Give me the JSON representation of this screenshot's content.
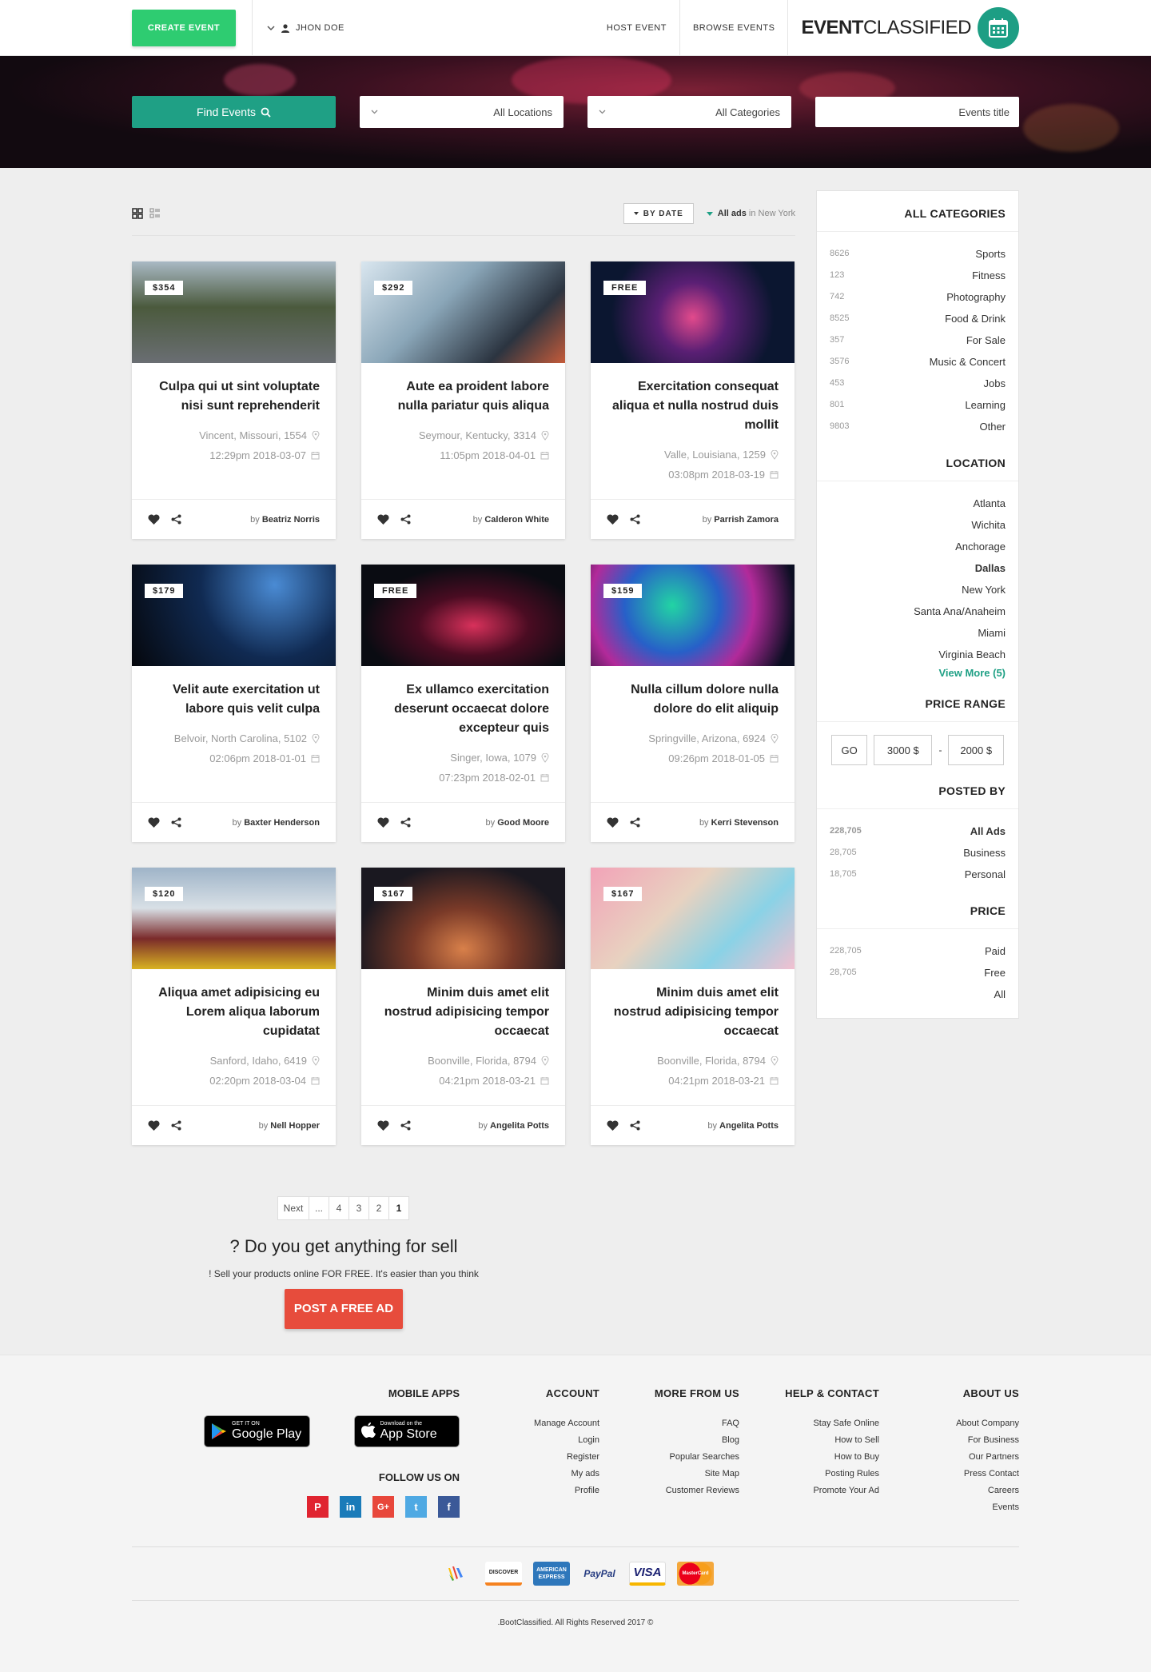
{
  "header": {
    "create_event": "CREATE EVENT",
    "user_name": "JHON DOE",
    "nav": [
      "HOST EVENT",
      "BROWSE EVENTS"
    ],
    "logo_bold": "EVENT",
    "logo_light": "CLASSIFIED"
  },
  "hero": {
    "find_events": "Find Events",
    "locations": "All Locations",
    "categories": "All Categories",
    "title_placeholder": "Events title"
  },
  "toolbar": {
    "sort_label": "BY DATE",
    "all_ads": "All ads",
    "location_suffix": "in New York"
  },
  "events": [
    {
      "price": "$354",
      "title": "Culpa qui ut sint voluptate nisi sunt reprehenderit",
      "location": "Vincent, Missouri, 1554",
      "datetime": "12:29pm 2018-03-07",
      "by": "by",
      "author": "Beatriz Norris"
    },
    {
      "price": "$292",
      "title": "Aute ea proident labore nulla pariatur quis aliqua",
      "location": "Seymour, Kentucky, 3314",
      "datetime": "11:05pm 2018-04-01",
      "by": "by",
      "author": "Calderon White"
    },
    {
      "price": "FREE",
      "title": "Exercitation consequat aliqua et nulla nostrud duis mollit",
      "location": "Valle, Louisiana, 1259",
      "datetime": "03:08pm 2018-03-19",
      "by": "by",
      "author": "Parrish Zamora"
    },
    {
      "price": "$179",
      "title": "Velit aute exercitation ut labore quis velit culpa",
      "location": "Belvoir, North Carolina, 5102",
      "datetime": "02:06pm 2018-01-01",
      "by": "by",
      "author": "Baxter Henderson"
    },
    {
      "price": "FREE",
      "title": "Ex ullamco exercitation deserunt occaecat dolore excepteur quis",
      "location": "Singer, Iowa, 1079",
      "datetime": "07:23pm 2018-02-01",
      "by": "by",
      "author": "Good Moore"
    },
    {
      "price": "$159",
      "title": "Nulla cillum dolore nulla dolore do elit aliquip",
      "location": "Springville, Arizona, 6924",
      "datetime": "09:26pm 2018-01-05",
      "by": "by",
      "author": "Kerri Stevenson"
    },
    {
      "price": "$120",
      "title": "Aliqua amet adipisicing eu Lorem aliqua laborum cupidatat",
      "location": "Sanford, Idaho, 6419",
      "datetime": "02:20pm 2018-03-04",
      "by": "by",
      "author": "Nell Hopper"
    },
    {
      "price": "$167",
      "title": "Minim duis amet elit nostrud adipisicing tempor occaecat",
      "location": "Boonville, Florida, 8794",
      "datetime": "04:21pm 2018-03-21",
      "by": "by",
      "author": "Angelita Potts"
    },
    {
      "price": "$167",
      "title": "Minim duis amet elit nostrud adipisicing tempor occaecat",
      "location": "Boonville, Florida, 8794",
      "datetime": "04:21pm 2018-03-21",
      "by": "by",
      "author": "Angelita Potts"
    }
  ],
  "sidebar": {
    "categories_title": "ALL CATEGORIES",
    "categories": [
      {
        "count": "8626",
        "name": "Sports"
      },
      {
        "count": "123",
        "name": "Fitness"
      },
      {
        "count": "742",
        "name": "Photography"
      },
      {
        "count": "8525",
        "name": "Food & Drink"
      },
      {
        "count": "357",
        "name": "For Sale"
      },
      {
        "count": "3576",
        "name": "Music & Concert"
      },
      {
        "count": "453",
        "name": "Jobs"
      },
      {
        "count": "801",
        "name": "Learning"
      },
      {
        "count": "9803",
        "name": "Other"
      }
    ],
    "location_title": "LOCATION",
    "locations": [
      "Atlanta",
      "Wichita",
      "Anchorage",
      "Dallas",
      "New York",
      "Santa Ana/Anaheim",
      "Miami",
      "Virginia Beach"
    ],
    "view_more": "View More (5)",
    "price_range_title": "PRICE RANGE",
    "go": "GO",
    "price_min": "3000 $",
    "price_dash": "-",
    "price_max": "2000 $",
    "posted_by_title": "POSTED BY",
    "posted_by": [
      {
        "count": "228,705",
        "name": "All Ads"
      },
      {
        "count": "28,705",
        "name": "Business"
      },
      {
        "count": "18,705",
        "name": "Personal"
      }
    ],
    "price_title": "PRICE",
    "price_options": [
      {
        "count": "228,705",
        "name": "Paid"
      },
      {
        "count": "28,705",
        "name": "Free"
      },
      {
        "count": "",
        "name": "All"
      }
    ]
  },
  "pagination": {
    "next": "Next",
    "pages": [
      "...",
      "4",
      "3",
      "2",
      "1"
    ]
  },
  "cta": {
    "title": "? Do you get anything for sell",
    "subtitle": "! Sell your products online FOR FREE. It's easier than you think",
    "button": "POST A FREE AD"
  },
  "footer": {
    "mobile_apps": "MOBILE APPS",
    "google_small": "GET IT ON",
    "google_big": "Google Play",
    "apple_small": "Download on the",
    "apple_big": "App Store",
    "follow": "FOLLOW US ON",
    "account_title": "ACCOUNT",
    "account": [
      "Manage Account",
      "Login",
      "Register",
      "My ads",
      "Profile"
    ],
    "more_title": "MORE FROM US",
    "more": [
      "FAQ",
      "Blog",
      "Popular Searches",
      "Site Map",
      "Customer Reviews"
    ],
    "help_title": "HELP & CONTACT",
    "help": [
      "Stay Safe Online",
      "How to Sell",
      "How to Buy",
      "Posting Rules",
      "Promote Your Ad"
    ],
    "about_title": "ABOUT US",
    "about": [
      "About Company",
      "For Business",
      "Our Partners",
      "Press Contact",
      "Careers",
      "Events"
    ],
    "payments": [
      "DISCOVER",
      "AMERICAN EXPRESS",
      "PayPal",
      "VISA",
      "MasterCard"
    ],
    "copyright": ".BootClassified. All Rights Reserved 2017 ©"
  },
  "colors": {
    "green": "#2ecc71",
    "teal": "#1fa085",
    "red": "#e74c3c"
  }
}
